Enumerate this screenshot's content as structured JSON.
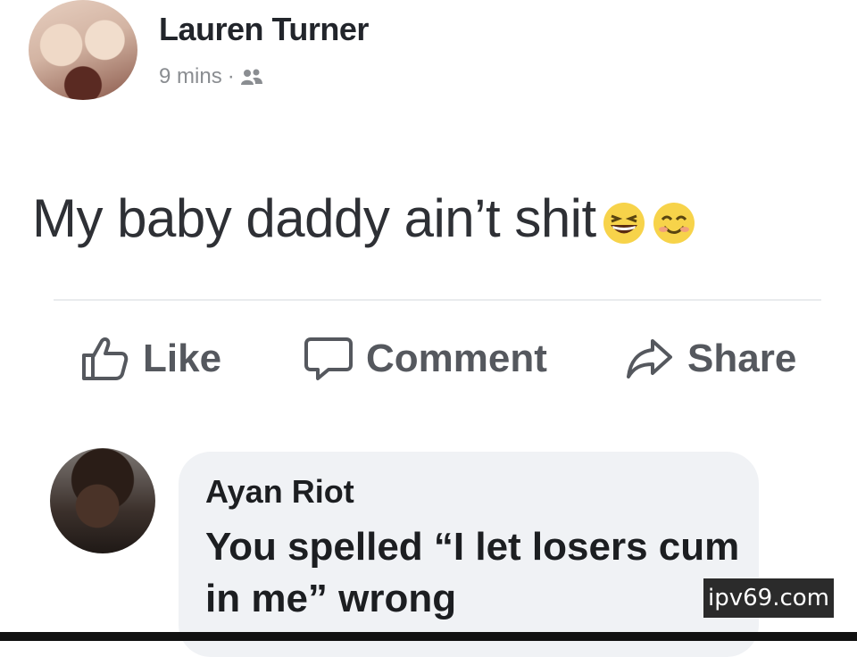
{
  "post": {
    "author": "Lauren Turner",
    "time": "9 mins",
    "separator": "·",
    "audience_icon": "friends-icon",
    "text": "My baby daddy ain’t shit",
    "emojis": [
      "grinning-squinting-face-emoji",
      "smiling-face-with-smiling-eyes-emoji"
    ]
  },
  "actions": {
    "like_label": "Like",
    "comment_label": "Comment",
    "share_label": "Share"
  },
  "comment": {
    "author": "Ayan Riot",
    "text": "You spelled “I let losers cum in me” wrong"
  },
  "watermark": "ipv69.com",
  "colors": {
    "action_text": "#55585e",
    "bubble": "#f0f2f5",
    "meta_text": "#8a8d91"
  }
}
